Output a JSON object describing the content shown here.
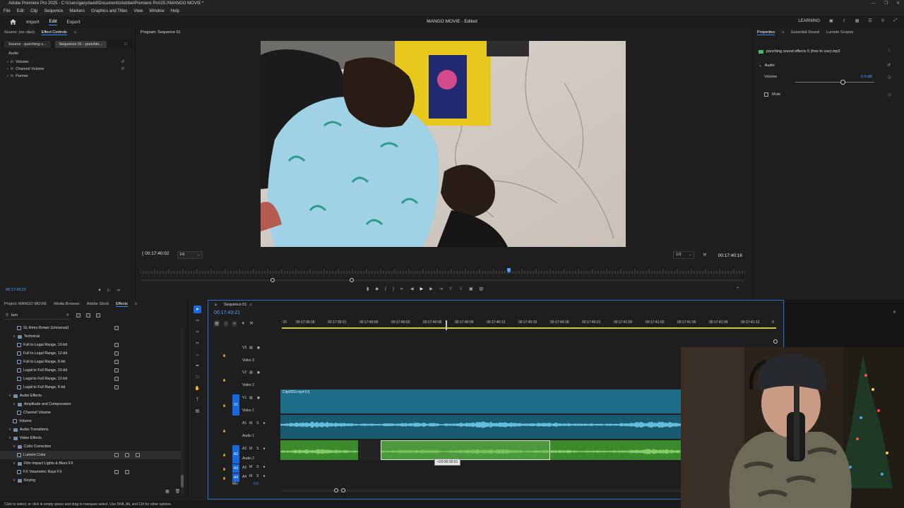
{
  "window": {
    "title": "Adobe Premiere Pro 2025 - C:\\Users\\garydavid\\Documents\\Adobe\\Premiere Pro\\25.0\\MANGO MOVIE *",
    "menu": [
      "File",
      "Edit",
      "Clip",
      "Sequence",
      "Markers",
      "Graphics and Titles",
      "View",
      "Window",
      "Help"
    ]
  },
  "workspace": {
    "tabs": [
      "Import",
      "Edit",
      "Export"
    ],
    "active_tab": "Edit",
    "document_title": "MANGO MOVIE - Edited",
    "learning_label": "LEARNING"
  },
  "effect_controls": {
    "tab_source": "Source: (no clips)",
    "tab_active": "Effect Controls",
    "chip_source": "Source - punching s...",
    "chip_sequence": "Sequence 01 - punchin...",
    "section": "Audio",
    "rows": [
      "Volume",
      "Channel Volume",
      "Panner"
    ],
    "timecode": "00:17:43:21"
  },
  "program": {
    "title": "Program: Sequence 01",
    "timecode_left": "00:17:40:02",
    "fit": "Fit",
    "resolution": "1/2",
    "timecode_right": "00:17:40:16"
  },
  "properties": {
    "tabs": [
      "Properties",
      "Essential Sound",
      "Lumetri Scopes"
    ],
    "file_name": "punching sound effects 5 (free to use).mp3",
    "section": "Audio",
    "volume_label": "Volume",
    "volume_value": "0.0 dB",
    "volume_level": 0.6,
    "mute_label": "Mute"
  },
  "project": {
    "tabs": [
      "Project: MANGO MOVIE",
      "Media Browser",
      "Adobe Stock",
      "Effects"
    ],
    "active_tab": "Effects",
    "search_value": "lum",
    "tree": [
      {
        "label": "SL Retro Brown (Universal)",
        "indent": 3,
        "kind": "fx",
        "badges": 1
      },
      {
        "label": "Technical",
        "indent": 2,
        "kind": "folder",
        "badges": 0
      },
      {
        "label": "Full to Legal Range, 10-bit",
        "indent": 3,
        "kind": "fx",
        "badges": 1
      },
      {
        "label": "Full to Legal Range, 12-bit",
        "indent": 3,
        "kind": "fx",
        "badges": 1
      },
      {
        "label": "Full to Legal Range, 8-bit",
        "indent": 3,
        "kind": "fx",
        "badges": 1
      },
      {
        "label": "Legal to Full Range, 10-bit",
        "indent": 3,
        "kind": "fx",
        "badges": 1
      },
      {
        "label": "Legal to Full Range, 12-bit",
        "indent": 3,
        "kind": "fx",
        "badges": 1
      },
      {
        "label": "Legal to Full Range, 8-bit",
        "indent": 3,
        "kind": "fx",
        "badges": 1
      },
      {
        "label": "Audio Effects",
        "indent": 1,
        "kind": "folder",
        "badges": 0
      },
      {
        "label": "Amplitude and Compression",
        "indent": 2,
        "kind": "folder",
        "badges": 0
      },
      {
        "label": "Channel Volume",
        "indent": 3,
        "kind": "fx",
        "badges": 0
      },
      {
        "label": "Volume",
        "indent": 2,
        "kind": "fx",
        "badges": 0
      },
      {
        "label": "Audio Transitions",
        "indent": 1,
        "kind": "folder",
        "badges": 0
      },
      {
        "label": "Video Effects",
        "indent": 1,
        "kind": "folder",
        "badges": 0
      },
      {
        "label": "Color Correction",
        "indent": 2,
        "kind": "folder",
        "badges": 0
      },
      {
        "label": "Lumetri Color",
        "indent": 3,
        "kind": "fx",
        "badges": 3,
        "selected": true
      },
      {
        "label": "Film Impact Lights & Blurs FX",
        "indent": 2,
        "kind": "folder",
        "badges": 0
      },
      {
        "label": "FX Volumetric Rays FX",
        "indent": 3,
        "kind": "fx",
        "badges": 2
      },
      {
        "label": "Keying",
        "indent": 2,
        "kind": "folder",
        "badges": 0
      }
    ]
  },
  "timeline": {
    "sequence_tab": "Sequence 01",
    "timecode": "00:17:43:21",
    "ruler_start": ":15",
    "ruler_end": "0",
    "ruler": [
      "00:17:39:18",
      "00:17:39:21",
      "00:17:40:00",
      "00:17:40:03",
      "00:17:40:06",
      "00:17:40:09",
      "00:17:40:12",
      "00:17:40:15",
      "00:17:40:18",
      "00:17:40:21",
      "00:17:41:00",
      "00:17:41:03",
      "00:17:41:06",
      "00:17:41:09",
      "00:17:41:12"
    ],
    "tracks": [
      {
        "id": "V3",
        "name": "Video 3"
      },
      {
        "id": "V2",
        "name": "Video 2"
      },
      {
        "id": "V1",
        "name": "Video 1",
        "target": "V1"
      },
      {
        "id": "A1",
        "name": "Audio 1"
      },
      {
        "id": "A2",
        "name": "Audio 2",
        "target": "A2"
      },
      {
        "id": "A3",
        "name": "",
        "target": "A3"
      },
      {
        "id": "A4",
        "name": "",
        "target": "A4"
      }
    ],
    "mix_label": "Mix",
    "mix_value": "0.0",
    "video_clip": "Clip0050.mp4 [V]",
    "drag_tooltip": "+00:00:00:01"
  },
  "status": {
    "hint": "Click to select, or click in empty space and drag to marquee select. Use Shift, Alt, and Ctrl for other options."
  },
  "colors": {
    "accent": "#2f8cff",
    "video_clip": "#1d6d89",
    "audio_clip_1": "#1a5a70",
    "audio_clip_2": "#3b8a2e",
    "target_blue": "#1769e0"
  }
}
